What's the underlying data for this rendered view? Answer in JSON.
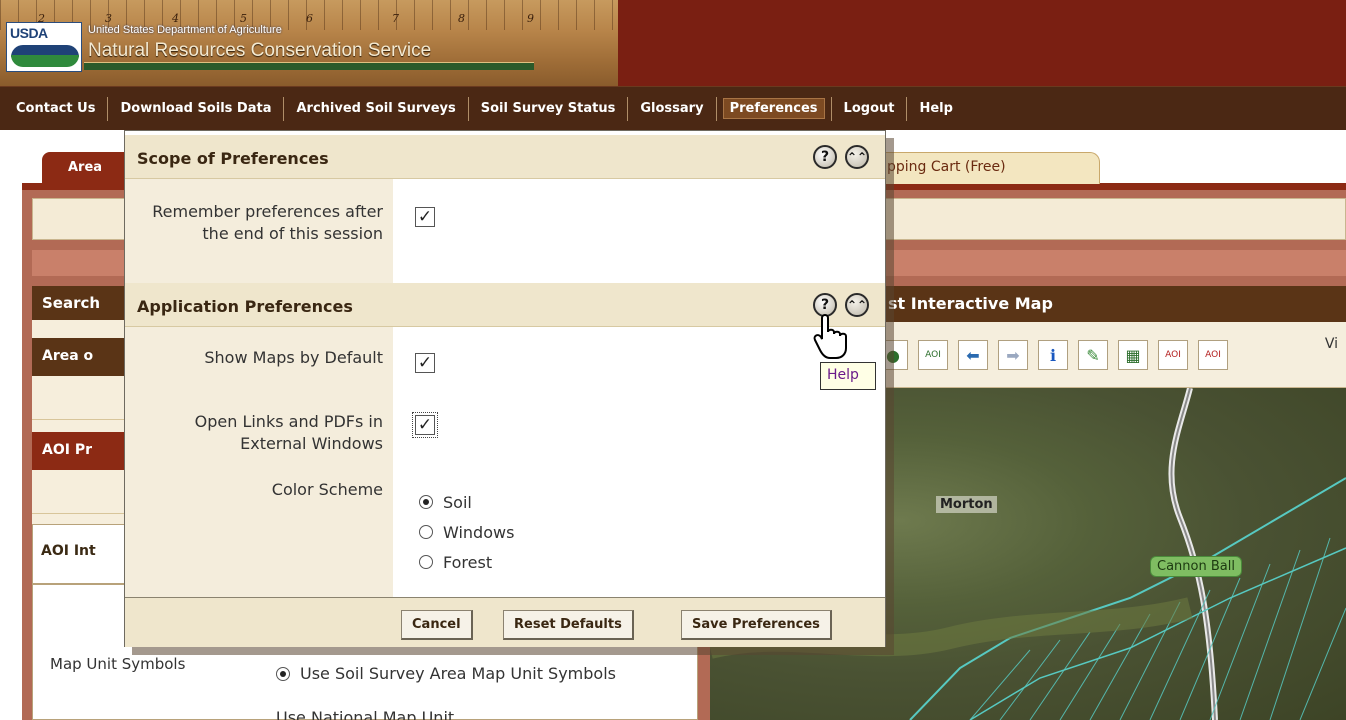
{
  "banner": {
    "agency_abbrev": "USDA",
    "department": "United States Department of Agriculture",
    "service": "Natural Resources Conservation Service",
    "ruler_numbers": [
      "2",
      "3",
      "4",
      "5",
      "6",
      "7",
      "8",
      "9"
    ]
  },
  "nav": {
    "items": [
      {
        "label": "Contact Us"
      },
      {
        "label": "Download Soils Data"
      },
      {
        "label": "Archived Soil Surveys"
      },
      {
        "label": "Soil Survey Status"
      },
      {
        "label": "Glossary"
      },
      {
        "label": "Preferences",
        "active": true
      },
      {
        "label": "Logout"
      },
      {
        "label": "Help"
      }
    ]
  },
  "background": {
    "tab_left_label": "Area",
    "tab_right_label": "pping Cart (Free)",
    "search_title": "Search",
    "area_title": "Area o",
    "aoi_properties_title": "AOI Pr",
    "aoi_interpretation_title": "AOI Int",
    "map_title": "st Interactive Map",
    "map_toolbar_text": "Vi",
    "map_unit_symbols_label": "Map Unit Symbols",
    "map_unit_option_1": "Use Soil Survey Area Map Unit Symbols",
    "map_unit_option_2_partial": "Use National Map Unit ...",
    "map_labels": {
      "morton": "Morton",
      "cannon_ball": "Cannon Ball"
    }
  },
  "preferences": {
    "scope": {
      "title": "Scope of Preferences",
      "remember_label": "Remember preferences after the end of this session",
      "remember_checked": true
    },
    "application": {
      "title": "Application Preferences",
      "show_maps_label": "Show Maps by Default",
      "show_maps_checked": true,
      "open_links_label": "Open Links and PDFs in External Windows",
      "open_links_checked": true,
      "color_scheme_label": "Color Scheme",
      "color_options": [
        {
          "label": "Soil",
          "selected": true
        },
        {
          "label": "Windows",
          "selected": false
        },
        {
          "label": "Forest",
          "selected": false
        }
      ]
    },
    "buttons": {
      "cancel": "Cancel",
      "reset": "Reset Defaults",
      "save": "Save Preferences"
    },
    "help_glyph": "?",
    "collapse_glyph": "⌃⌃",
    "tooltip": "Help"
  },
  "colors": {
    "banner_red": "#7a1f12",
    "nav_brown": "#4b2814",
    "header_tan": "#efe6cc",
    "label_tan": "#f4eddc",
    "accent_red": "#8c2a14"
  }
}
